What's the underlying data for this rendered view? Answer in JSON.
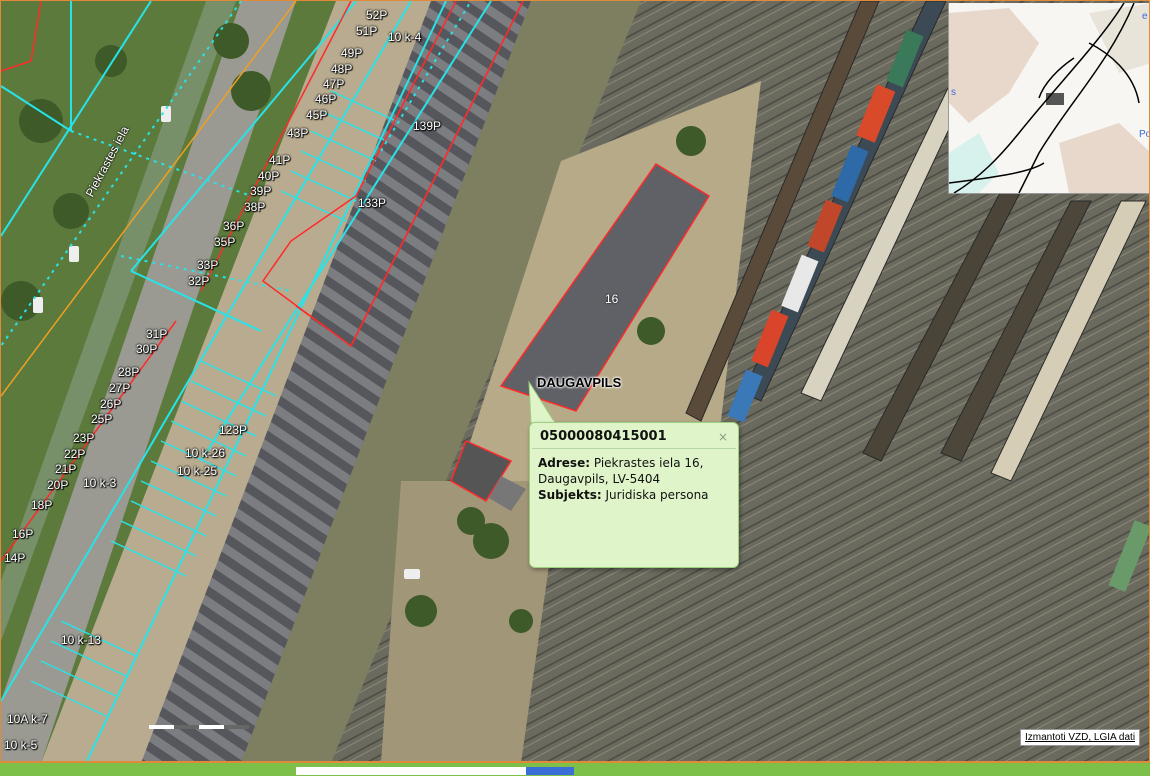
{
  "map": {
    "street_name": "Piekrastes iela",
    "city_label": "DAUGAVPILS",
    "building_number": "16",
    "parcel_labels": [
      "52P",
      "51P",
      "10 k-4",
      "49P",
      "48P",
      "47P",
      "46P",
      "45P",
      "43P",
      "139P",
      "41P",
      "40P",
      "39P",
      "38P",
      "133P",
      "36P",
      "35P",
      "33P",
      "32P",
      "31P",
      "30P",
      "28P",
      "27P",
      "26P",
      "25P",
      "123P",
      "23P",
      "22P",
      "21P",
      "20P",
      "10 k-26",
      "10 k-25",
      "10 k-3",
      "18P",
      "16P",
      "14P",
      "10 k-13",
      "10A k-7",
      "10 k-5"
    ]
  },
  "popup": {
    "cadastre_number": "05000080415001",
    "close_symbol": "×",
    "address_label": "Adrese:",
    "address_value": "Piekrastes iela 16, Daugavpils, LV-5404",
    "subject_label": "Subjekts:",
    "subject_value": "Juridiska persona"
  },
  "attribution": "Izmantoti VZD, LGIA dati",
  "colors": {
    "parcel_outline": "#ff2a2a",
    "boundary_line": "#27e3e8",
    "street_line": "#f0a020",
    "popup_bg": "#dff5c9",
    "bottom_bar": "#7cc04a"
  }
}
